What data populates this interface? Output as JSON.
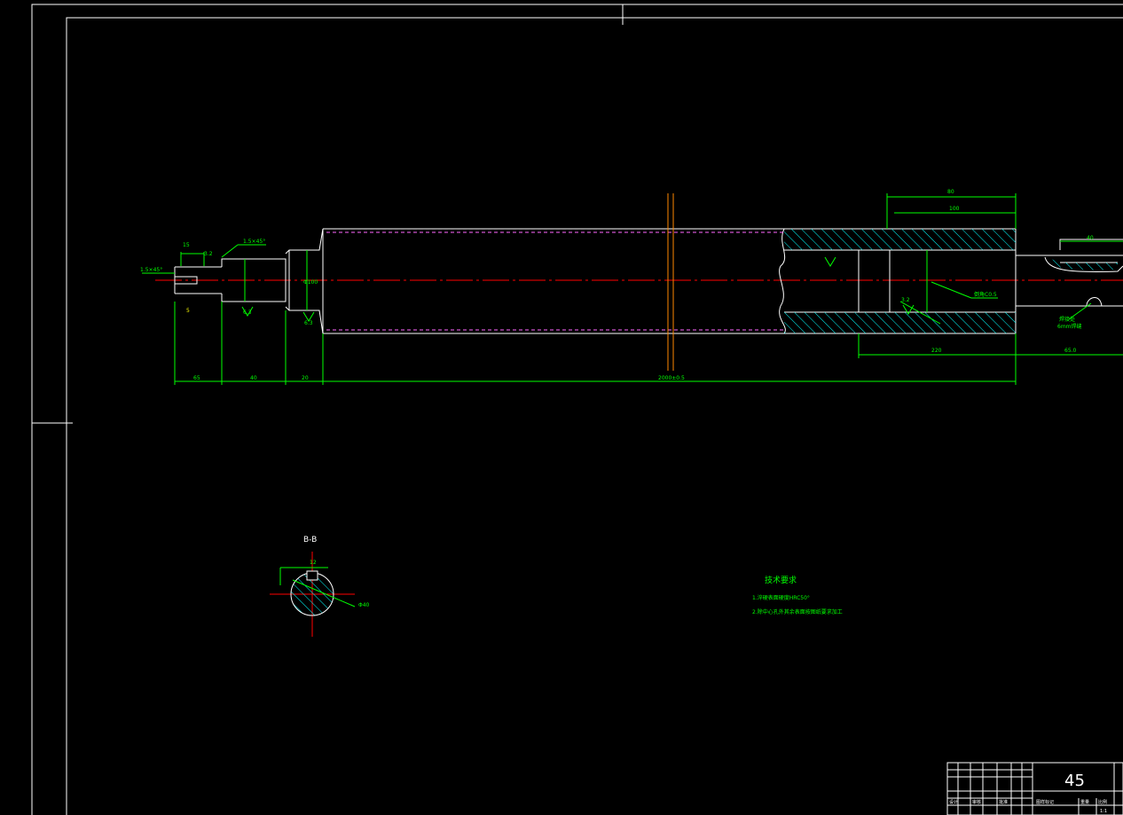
{
  "drawing": {
    "section_label": "B-B",
    "material": "45",
    "scale": "1:1",
    "tech_requirements": {
      "title": "技术要求",
      "items": [
        "1.淬硬表面硬度HRC50°",
        "2.除中心孔外其余表面按图纸要求加工"
      ]
    },
    "dimensions": {
      "chamfer_left": "1.5×45°",
      "chamfer_step": "1.5×45°",
      "d_15": "15",
      "d_65": "65",
      "d_40": "40",
      "d_20": "20",
      "d_main": "2000±0.5",
      "d_top_a": "80",
      "d_top_b": "100",
      "d_220": "220",
      "d_right": "65.0",
      "d_right_top": "40",
      "roughness_1": "6.3",
      "roughness_2": "6.3",
      "roughness_3": "3.2",
      "roughness_4": "3.2",
      "key_w": "12",
      "key_d": "5",
      "key_dia": "Φ40",
      "label_bore": "Φ100",
      "label_inner": "倒角C0.5",
      "label_weld": "焊接处",
      "label_weld2": "6mm焊缝"
    },
    "title_block": {
      "row1": "设计",
      "row2": "审核",
      "row3": "批准",
      "col_a": "图样标记",
      "col_b": "重量",
      "col_c": "比例"
    }
  }
}
